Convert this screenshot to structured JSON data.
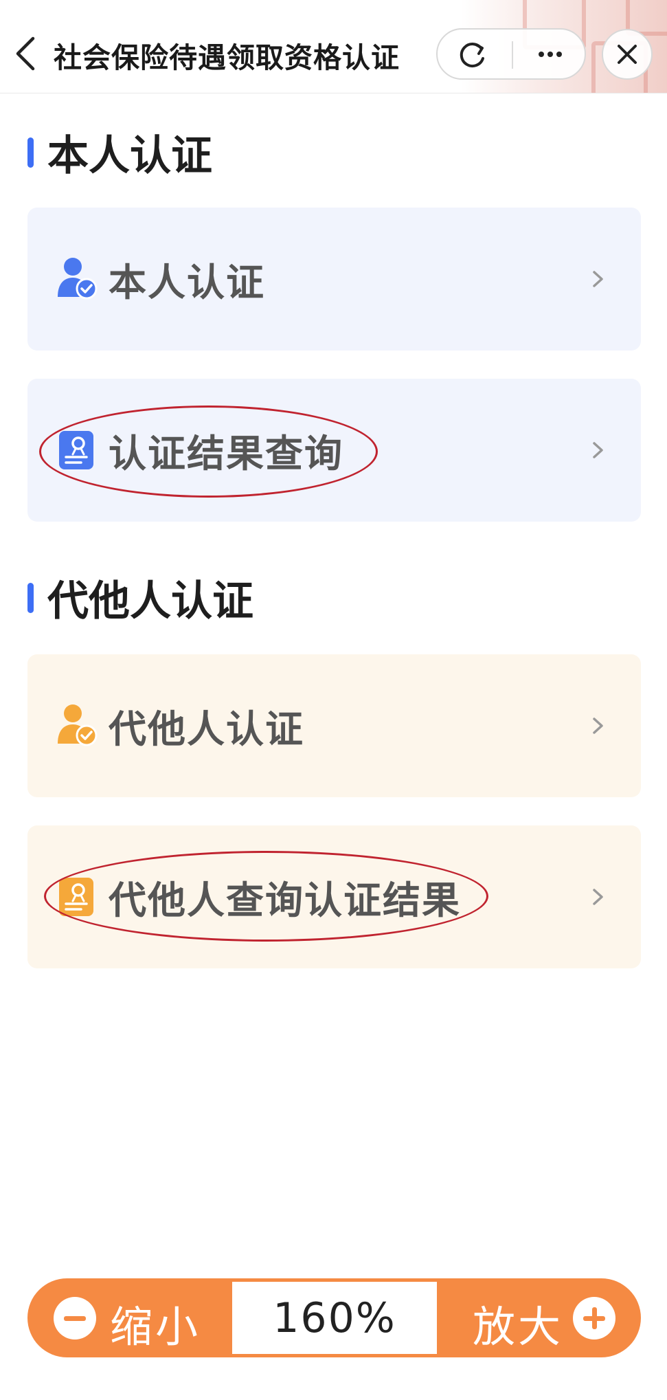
{
  "nav": {
    "title": "社会保险待遇领取资格认证"
  },
  "sections": [
    {
      "title": "本人认证",
      "items": [
        {
          "label": "本人认证",
          "icon": "user-check-icon",
          "color": "#4a78ef"
        },
        {
          "label": "认证结果查询",
          "icon": "certificate-icon",
          "color": "#4a78ef"
        }
      ]
    },
    {
      "title": "代他人认证",
      "items": [
        {
          "label": "代他人认证",
          "icon": "user-check-icon",
          "color": "#f5a83a"
        },
        {
          "label": "代他人查询认证结果",
          "icon": "certificate-icon",
          "color": "#f5a83a"
        }
      ]
    }
  ],
  "zoom": {
    "out_label": "缩小",
    "value": "160%",
    "in_label": "放大"
  },
  "colors": {
    "accent_blue": "#3d6ef5",
    "accent_orange": "#f58a43",
    "annotation_red": "#c0232f"
  }
}
